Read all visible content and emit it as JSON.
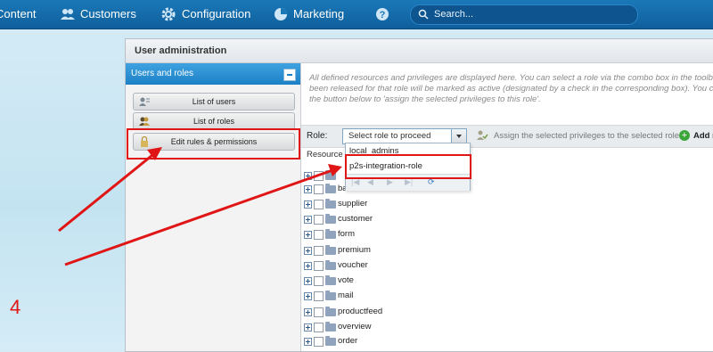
{
  "topnav": {
    "items": [
      {
        "label": "Content",
        "icon": "content-icon"
      },
      {
        "label": "Customers",
        "icon": "customers-icon"
      },
      {
        "label": "Configuration",
        "icon": "gear-icon"
      },
      {
        "label": "Marketing",
        "icon": "pie-chart-icon"
      },
      {
        "label": "",
        "icon": "help-icon"
      }
    ],
    "search_placeholder": "Search..."
  },
  "window": {
    "title": "User administration",
    "left_panel": {
      "title": "Users and roles",
      "buttons": [
        {
          "label": "List of users",
          "icon": "users-list-icon"
        },
        {
          "label": "List of roles",
          "icon": "roles-icon"
        },
        {
          "label": "Edit rules & permissions",
          "icon": "lock-icon"
        }
      ]
    },
    "info_text": "All defined resources and privileges are displayed here. You can select a role via the combo box in the toolb been released for that role will be marked as active (designated by a check in the corresponding box). You c the button below to 'assign the selected privileges to this role'.",
    "toolbar": {
      "role_label": "Role:",
      "role_select_value": "Select role to proceed",
      "assign_label": "Assign the selected privileges to the selected role.",
      "add_label": "Add re"
    },
    "resources_header": "Resource",
    "dropdown_options": [
      "local_admins",
      "p2s-integration-role"
    ],
    "tree_items": [
      "ba",
      "supplier",
      "customer",
      "form",
      "premium",
      "voucher",
      "vote",
      "mail",
      "productfeed",
      "overview",
      "order"
    ]
  },
  "annotation": {
    "step_number": "4",
    "color": "#e01616"
  }
}
